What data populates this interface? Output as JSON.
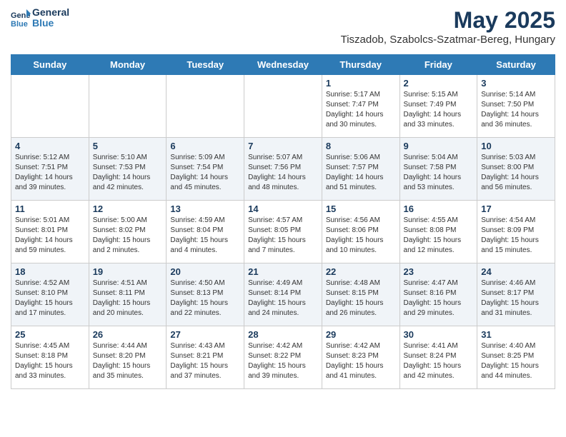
{
  "header": {
    "logo_line1": "General",
    "logo_line2": "Blue",
    "month_title": "May 2025",
    "subtitle": "Tiszadob, Szabolcs-Szatmar-Bereg, Hungary"
  },
  "weekdays": [
    "Sunday",
    "Monday",
    "Tuesday",
    "Wednesday",
    "Thursday",
    "Friday",
    "Saturday"
  ],
  "weeks": [
    [
      {
        "day": "",
        "info": ""
      },
      {
        "day": "",
        "info": ""
      },
      {
        "day": "",
        "info": ""
      },
      {
        "day": "",
        "info": ""
      },
      {
        "day": "1",
        "info": "Sunrise: 5:17 AM\nSunset: 7:47 PM\nDaylight: 14 hours\nand 30 minutes."
      },
      {
        "day": "2",
        "info": "Sunrise: 5:15 AM\nSunset: 7:49 PM\nDaylight: 14 hours\nand 33 minutes."
      },
      {
        "day": "3",
        "info": "Sunrise: 5:14 AM\nSunset: 7:50 PM\nDaylight: 14 hours\nand 36 minutes."
      }
    ],
    [
      {
        "day": "4",
        "info": "Sunrise: 5:12 AM\nSunset: 7:51 PM\nDaylight: 14 hours\nand 39 minutes."
      },
      {
        "day": "5",
        "info": "Sunrise: 5:10 AM\nSunset: 7:53 PM\nDaylight: 14 hours\nand 42 minutes."
      },
      {
        "day": "6",
        "info": "Sunrise: 5:09 AM\nSunset: 7:54 PM\nDaylight: 14 hours\nand 45 minutes."
      },
      {
        "day": "7",
        "info": "Sunrise: 5:07 AM\nSunset: 7:56 PM\nDaylight: 14 hours\nand 48 minutes."
      },
      {
        "day": "8",
        "info": "Sunrise: 5:06 AM\nSunset: 7:57 PM\nDaylight: 14 hours\nand 51 minutes."
      },
      {
        "day": "9",
        "info": "Sunrise: 5:04 AM\nSunset: 7:58 PM\nDaylight: 14 hours\nand 53 minutes."
      },
      {
        "day": "10",
        "info": "Sunrise: 5:03 AM\nSunset: 8:00 PM\nDaylight: 14 hours\nand 56 minutes."
      }
    ],
    [
      {
        "day": "11",
        "info": "Sunrise: 5:01 AM\nSunset: 8:01 PM\nDaylight: 14 hours\nand 59 minutes."
      },
      {
        "day": "12",
        "info": "Sunrise: 5:00 AM\nSunset: 8:02 PM\nDaylight: 15 hours\nand 2 minutes."
      },
      {
        "day": "13",
        "info": "Sunrise: 4:59 AM\nSunset: 8:04 PM\nDaylight: 15 hours\nand 4 minutes."
      },
      {
        "day": "14",
        "info": "Sunrise: 4:57 AM\nSunset: 8:05 PM\nDaylight: 15 hours\nand 7 minutes."
      },
      {
        "day": "15",
        "info": "Sunrise: 4:56 AM\nSunset: 8:06 PM\nDaylight: 15 hours\nand 10 minutes."
      },
      {
        "day": "16",
        "info": "Sunrise: 4:55 AM\nSunset: 8:08 PM\nDaylight: 15 hours\nand 12 minutes."
      },
      {
        "day": "17",
        "info": "Sunrise: 4:54 AM\nSunset: 8:09 PM\nDaylight: 15 hours\nand 15 minutes."
      }
    ],
    [
      {
        "day": "18",
        "info": "Sunrise: 4:52 AM\nSunset: 8:10 PM\nDaylight: 15 hours\nand 17 minutes."
      },
      {
        "day": "19",
        "info": "Sunrise: 4:51 AM\nSunset: 8:11 PM\nDaylight: 15 hours\nand 20 minutes."
      },
      {
        "day": "20",
        "info": "Sunrise: 4:50 AM\nSunset: 8:13 PM\nDaylight: 15 hours\nand 22 minutes."
      },
      {
        "day": "21",
        "info": "Sunrise: 4:49 AM\nSunset: 8:14 PM\nDaylight: 15 hours\nand 24 minutes."
      },
      {
        "day": "22",
        "info": "Sunrise: 4:48 AM\nSunset: 8:15 PM\nDaylight: 15 hours\nand 26 minutes."
      },
      {
        "day": "23",
        "info": "Sunrise: 4:47 AM\nSunset: 8:16 PM\nDaylight: 15 hours\nand 29 minutes."
      },
      {
        "day": "24",
        "info": "Sunrise: 4:46 AM\nSunset: 8:17 PM\nDaylight: 15 hours\nand 31 minutes."
      }
    ],
    [
      {
        "day": "25",
        "info": "Sunrise: 4:45 AM\nSunset: 8:18 PM\nDaylight: 15 hours\nand 33 minutes."
      },
      {
        "day": "26",
        "info": "Sunrise: 4:44 AM\nSunset: 8:20 PM\nDaylight: 15 hours\nand 35 minutes."
      },
      {
        "day": "27",
        "info": "Sunrise: 4:43 AM\nSunset: 8:21 PM\nDaylight: 15 hours\nand 37 minutes."
      },
      {
        "day": "28",
        "info": "Sunrise: 4:42 AM\nSunset: 8:22 PM\nDaylight: 15 hours\nand 39 minutes."
      },
      {
        "day": "29",
        "info": "Sunrise: 4:42 AM\nSunset: 8:23 PM\nDaylight: 15 hours\nand 41 minutes."
      },
      {
        "day": "30",
        "info": "Sunrise: 4:41 AM\nSunset: 8:24 PM\nDaylight: 15 hours\nand 42 minutes."
      },
      {
        "day": "31",
        "info": "Sunrise: 4:40 AM\nSunset: 8:25 PM\nDaylight: 15 hours\nand 44 minutes."
      }
    ]
  ]
}
